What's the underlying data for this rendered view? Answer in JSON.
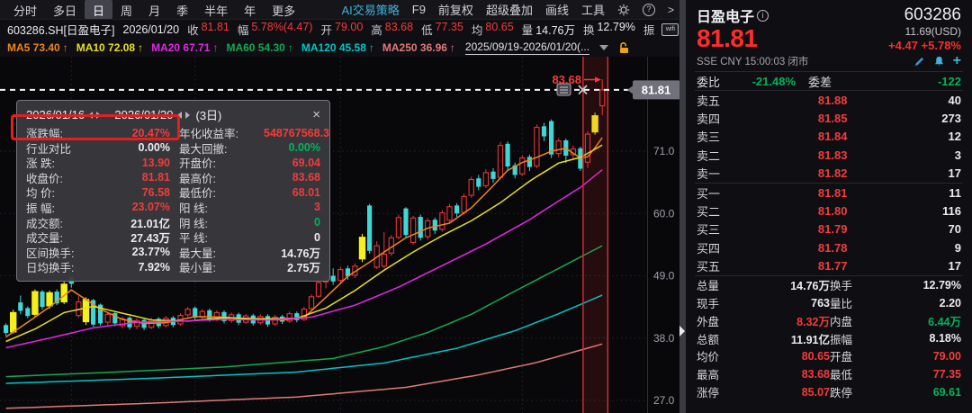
{
  "toolbar": {
    "tabs": [
      {
        "label": "分时",
        "active": false
      },
      {
        "label": "多日",
        "active": false
      },
      {
        "label": "日",
        "active": true
      },
      {
        "label": "周",
        "active": false
      },
      {
        "label": "月",
        "active": false
      },
      {
        "label": "季",
        "active": false
      },
      {
        "label": "半年",
        "active": false
      },
      {
        "label": "年",
        "active": false
      },
      {
        "label": "更多",
        "active": false
      }
    ],
    "right_items": [
      {
        "label": "AI交易策略",
        "accent": true
      },
      {
        "label": "F9",
        "accent": false
      },
      {
        "label": "前复权",
        "accent": false
      },
      {
        "label": "超级叠加",
        "accent": false
      },
      {
        "label": "画线",
        "accent": false
      },
      {
        "label": "工具",
        "accent": false
      }
    ],
    "help_label": "?",
    "chevron_label": ">"
  },
  "info_line": {
    "code": "603286.SH[日盈电子]",
    "date": "2026/01/20",
    "fields": [
      {
        "label": "收",
        "value": "81.81",
        "color": "r"
      },
      {
        "label": "幅",
        "value": "5.78%(4.47)",
        "color": "r"
      },
      {
        "label": "开",
        "value": "79.00",
        "color": "r"
      },
      {
        "label": "高",
        "value": "83.68",
        "color": "r"
      },
      {
        "label": "低",
        "value": "77.35",
        "color": "r"
      },
      {
        "label": "均",
        "value": "80.65",
        "color": "r"
      },
      {
        "label": "量",
        "value": "14.76万",
        "color": "w"
      },
      {
        "label": "换",
        "value": "12.79%",
        "color": "w"
      },
      {
        "label": "振",
        "value": "",
        "color": "w"
      }
    ],
    "cast_icon_text": "wifi"
  },
  "ma_line": {
    "items": [
      {
        "label": "MA5",
        "value": "73.40",
        "color": "#f0851d"
      },
      {
        "label": "MA10",
        "value": "72.08",
        "color": "#e8e020"
      },
      {
        "label": "MA20",
        "value": "67.71",
        "color": "#e129e1"
      },
      {
        "label": "MA60",
        "value": "54.30",
        "color": "#12a952"
      },
      {
        "label": "MA120",
        "value": "45.58",
        "color": "#00c5c5"
      },
      {
        "label": "MA250",
        "value": "36.96",
        "color": "#e07a7a"
      }
    ],
    "arrow": "↑",
    "range_text": "2025/09/19-2026/01/20(..."
  },
  "chart_data": {
    "type": "candlestick",
    "date_range": "2025/09/19-2026/01/20",
    "y_ticks": [
      71.0,
      60.0,
      49.0,
      38.0,
      27.0
    ],
    "v_grid_days": [
      9,
      26,
      46,
      71
    ],
    "price_line": {
      "value": 81.81,
      "label": "81.81"
    },
    "high_annotation": {
      "value": 83.68,
      "label": "83.68"
    },
    "selection": {
      "start_index": 80,
      "end_index": 82,
      "start_date": "2026/01/16",
      "end_date": "2026/01/20"
    },
    "up_color": "#e83535",
    "down_color": "#3fd6d6",
    "mark_color": "#f6ef1a",
    "candles": [
      [
        40.3,
        38.9,
        38.4,
        40.6,
        "c"
      ],
      [
        39.0,
        42.6,
        38.8,
        43.0,
        "y"
      ],
      [
        44.3,
        42.8,
        42.2,
        45.5,
        "c"
      ],
      [
        43.3,
        41.9,
        41.5,
        43.6,
        "c"
      ],
      [
        42.1,
        46.3,
        41.8,
        46.6,
        "y"
      ],
      [
        46.2,
        43.5,
        43.0,
        46.5,
        "c"
      ],
      [
        43.6,
        46.1,
        43.2,
        46.4,
        "y"
      ],
      [
        46.2,
        44.1,
        43.8,
        46.6,
        "c"
      ],
      [
        44.3,
        47.6,
        44.0,
        48.0,
        "y"
      ],
      [
        48.8,
        47.6,
        46.9,
        48.9,
        "c"
      ],
      [
        42.0,
        44.4,
        41.6,
        45.4,
        "r"
      ],
      [
        40.8,
        44.9,
        40.3,
        45.2,
        "y"
      ],
      [
        44.7,
        40.4,
        40.0,
        44.9,
        "c"
      ],
      [
        43.9,
        40.6,
        40.2,
        44.1,
        "c"
      ],
      [
        40.8,
        42.2,
        40.3,
        42.6,
        "r"
      ],
      [
        42.4,
        40.6,
        40.1,
        42.7,
        "c"
      ],
      [
        40.2,
        41.4,
        39.7,
        41.8,
        "r"
      ],
      [
        41.6,
        39.9,
        39.5,
        41.9,
        "c"
      ],
      [
        40.1,
        41.1,
        39.6,
        41.5,
        "r"
      ],
      [
        41.2,
        39.8,
        39.4,
        41.4,
        "c"
      ],
      [
        39.9,
        41.2,
        39.6,
        41.6,
        "r"
      ],
      [
        41.4,
        40.1,
        39.7,
        41.7,
        "c"
      ],
      [
        40.2,
        41.5,
        39.9,
        41.9,
        "r"
      ],
      [
        41.6,
        40.3,
        39.9,
        41.9,
        "c"
      ],
      [
        40.5,
        42.0,
        40.2,
        42.4,
        "r"
      ],
      [
        42.1,
        43.1,
        41.7,
        43.5,
        "r"
      ],
      [
        43.3,
        41.6,
        41.2,
        43.6,
        "c"
      ],
      [
        41.7,
        42.7,
        41.3,
        43.1,
        "r"
      ],
      [
        42.9,
        41.3,
        40.9,
        43.2,
        "c"
      ],
      [
        41.4,
        42.5,
        41.0,
        42.9,
        "r"
      ],
      [
        42.6,
        41.0,
        40.6,
        42.9,
        "c"
      ],
      [
        41.1,
        42.1,
        40.7,
        42.5,
        "r"
      ],
      [
        42.2,
        40.7,
        40.3,
        42.5,
        "c"
      ],
      [
        40.8,
        41.9,
        40.5,
        42.3,
        "r"
      ],
      [
        42.0,
        40.6,
        40.2,
        42.3,
        "c"
      ],
      [
        40.7,
        41.8,
        40.4,
        42.2,
        "r"
      ],
      [
        41.9,
        40.4,
        40.0,
        42.2,
        "c"
      ],
      [
        40.5,
        41.7,
        40.2,
        42.1,
        "r"
      ],
      [
        41.8,
        40.9,
        40.5,
        42.1,
        "c"
      ],
      [
        41.0,
        42.3,
        40.7,
        42.7,
        "r"
      ],
      [
        42.4,
        41.2,
        40.8,
        42.7,
        "c"
      ],
      [
        41.3,
        43.1,
        41.0,
        43.5,
        "r"
      ],
      [
        43.2,
        45.3,
        42.9,
        45.7,
        "r"
      ],
      [
        45.4,
        47.8,
        45.1,
        48.2,
        "r"
      ],
      [
        47.9,
        48.6,
        46.8,
        49.3,
        "r"
      ],
      [
        49.0,
        48.0,
        47.4,
        50.3,
        "c"
      ],
      [
        48.2,
        50.1,
        47.8,
        50.6,
        "r"
      ],
      [
        50.3,
        48.9,
        48.3,
        50.8,
        "c"
      ],
      [
        49.1,
        50.7,
        48.6,
        51.2,
        "r"
      ],
      [
        51.9,
        55.9,
        51.4,
        56.4,
        "y"
      ],
      [
        61.4,
        53.4,
        52.9,
        61.7,
        "c"
      ],
      [
        50.5,
        54.3,
        50.2,
        55.1,
        "r"
      ],
      [
        50.7,
        52.8,
        50.3,
        56.7,
        "r"
      ],
      [
        53.0,
        55.7,
        52.5,
        56.2,
        "r"
      ],
      [
        55.8,
        59.3,
        55.4,
        59.8,
        "r"
      ],
      [
        60.9,
        56.2,
        55.7,
        61.1,
        "c"
      ],
      [
        54.9,
        59.2,
        54.5,
        59.6,
        "r"
      ],
      [
        59.4,
        55.7,
        55.2,
        59.8,
        "c"
      ],
      [
        55.9,
        58.7,
        55.4,
        59.2,
        "r"
      ],
      [
        58.9,
        57.0,
        56.4,
        59.3,
        "c"
      ],
      [
        57.2,
        60.1,
        56.8,
        60.6,
        "r"
      ],
      [
        58.8,
        61.2,
        58.4,
        61.7,
        "r"
      ],
      [
        61.4,
        60.0,
        59.4,
        61.8,
        "c"
      ],
      [
        60.2,
        63.0,
        59.8,
        63.5,
        "r"
      ],
      [
        63.2,
        66.0,
        62.8,
        66.5,
        "r"
      ],
      [
        66.2,
        64.7,
        64.1,
        66.8,
        "c"
      ],
      [
        64.9,
        67.2,
        64.5,
        67.8,
        "r"
      ],
      [
        67.4,
        66.1,
        65.4,
        68.0,
        "c"
      ],
      [
        66.4,
        72.0,
        66.0,
        72.6,
        "r"
      ],
      [
        72.3,
        68.3,
        67.6,
        72.7,
        "c"
      ],
      [
        68.5,
        66.8,
        66.2,
        69.0,
        "c"
      ],
      [
        67.0,
        69.8,
        66.6,
        70.3,
        "r"
      ],
      [
        70.0,
        68.2,
        67.5,
        70.4,
        "c"
      ],
      [
        68.4,
        75.2,
        68.0,
        75.7,
        "r"
      ],
      [
        75.4,
        73.6,
        72.8,
        76.0,
        "c"
      ],
      [
        76.3,
        70.4,
        69.8,
        76.6,
        "c"
      ],
      [
        70.6,
        72.8,
        69.9,
        73.3,
        "r"
      ],
      [
        72.9,
        70.2,
        68.9,
        73.2,
        "c"
      ],
      [
        70.4,
        71.4,
        69.6,
        72.0,
        "r"
      ],
      [
        71.5,
        67.91,
        67.5,
        71.8,
        "c"
      ],
      [
        69.04,
        74.0,
        68.01,
        74.5,
        "r"
      ],
      [
        74.3,
        77.34,
        73.9,
        77.8,
        "y"
      ],
      [
        79.0,
        81.81,
        77.35,
        83.68,
        "r"
      ]
    ],
    "ma_series": [
      {
        "name": "MA5",
        "color": "#f0851d",
        "points": [
          [
            0,
            38.2
          ],
          [
            3,
            40.8
          ],
          [
            6,
            43.5
          ],
          [
            9,
            46.5
          ],
          [
            11,
            44.8
          ],
          [
            13,
            43.1
          ],
          [
            16,
            41.3
          ],
          [
            19,
            40.6
          ],
          [
            22,
            40.7
          ],
          [
            26,
            41.8
          ],
          [
            30,
            41.7
          ],
          [
            34,
            41.3
          ],
          [
            38,
            41.2
          ],
          [
            41,
            41.6
          ],
          [
            44,
            45.2
          ],
          [
            47,
            48.9
          ],
          [
            50,
            51.4
          ],
          [
            52,
            53.2
          ],
          [
            55,
            55.7
          ],
          [
            58,
            57.4
          ],
          [
            61,
            58.3
          ],
          [
            64,
            61.0
          ],
          [
            67,
            64.9
          ],
          [
            69,
            67.6
          ],
          [
            71,
            69.0
          ],
          [
            73,
            69.9
          ],
          [
            75,
            71.0
          ],
          [
            77,
            71.5
          ],
          [
            79,
            69.8
          ],
          [
            80,
            70.0
          ],
          [
            81,
            71.6
          ],
          [
            82,
            73.4
          ]
        ]
      },
      {
        "name": "MA10",
        "color": "#e8e020",
        "points": [
          [
            0,
            37.4
          ],
          [
            4,
            39.6
          ],
          [
            8,
            42.5
          ],
          [
            12,
            43.6
          ],
          [
            16,
            42.4
          ],
          [
            20,
            41.2
          ],
          [
            25,
            41.0
          ],
          [
            30,
            41.6
          ],
          [
            35,
            41.4
          ],
          [
            40,
            41.5
          ],
          [
            44,
            43.3
          ],
          [
            48,
            46.4
          ],
          [
            52,
            50.0
          ],
          [
            56,
            53.2
          ],
          [
            60,
            56.1
          ],
          [
            64,
            58.7
          ],
          [
            68,
            61.9
          ],
          [
            72,
            65.7
          ],
          [
            76,
            68.9
          ],
          [
            79,
            69.9
          ],
          [
            82,
            72.08
          ]
        ]
      },
      {
        "name": "MA20",
        "color": "#e129e1",
        "points": [
          [
            0,
            36.3
          ],
          [
            6,
            38.0
          ],
          [
            12,
            39.8
          ],
          [
            18,
            40.8
          ],
          [
            24,
            41.0
          ],
          [
            30,
            41.3
          ],
          [
            36,
            41.2
          ],
          [
            42,
            41.7
          ],
          [
            48,
            43.8
          ],
          [
            54,
            47.0
          ],
          [
            60,
            50.8
          ],
          [
            66,
            54.6
          ],
          [
            72,
            58.9
          ],
          [
            76,
            62.2
          ],
          [
            79,
            64.6
          ],
          [
            82,
            67.71
          ]
        ]
      },
      {
        "name": "MA60",
        "color": "#12a952",
        "points": [
          [
            0,
            31.2
          ],
          [
            15,
            32.0
          ],
          [
            30,
            32.9
          ],
          [
            45,
            34.4
          ],
          [
            52,
            36.5
          ],
          [
            58,
            39.0
          ],
          [
            64,
            42.2
          ],
          [
            70,
            46.3
          ],
          [
            76,
            50.3
          ],
          [
            82,
            54.3
          ]
        ]
      },
      {
        "name": "MA120",
        "color": "#00c5c5",
        "points": [
          [
            0,
            30.0
          ],
          [
            20,
            30.9
          ],
          [
            40,
            32.0
          ],
          [
            52,
            33.6
          ],
          [
            62,
            36.2
          ],
          [
            70,
            39.3
          ],
          [
            76,
            42.3
          ],
          [
            82,
            45.58
          ]
        ]
      },
      {
        "name": "MA250",
        "color": "#e07a7a",
        "points": [
          [
            0,
            25.6
          ],
          [
            20,
            26.5
          ],
          [
            40,
            27.6
          ],
          [
            55,
            29.3
          ],
          [
            65,
            31.5
          ],
          [
            73,
            33.7
          ],
          [
            82,
            36.96
          ]
        ]
      }
    ]
  },
  "popup": {
    "date_from": "2026/01/16",
    "dash": "-",
    "date_to": "2026/01/20",
    "span": "(3日)",
    "close": "×",
    "rows": [
      [
        "涨跌幅:",
        "20.47%",
        "r",
        "年化收益率:",
        "548767568.3",
        "r"
      ],
      [
        "行业对比",
        "0.00%",
        "w",
        "最大回撤:",
        "0.00%",
        "g"
      ],
      [
        "涨 跌:",
        "13.90",
        "r",
        "开盘价:",
        "69.04",
        "r"
      ],
      [
        "收盘价:",
        "81.81",
        "r",
        "最高价:",
        "83.68",
        "r"
      ],
      [
        "均 价:",
        "76.58",
        "r",
        "最低价:",
        "68.01",
        "r"
      ],
      [
        "振 幅:",
        "23.07%",
        "r",
        "阳 线:",
        "3",
        "r"
      ],
      [
        "成交额:",
        "21.01亿",
        "w",
        "阴 线:",
        "0",
        "g"
      ],
      [
        "成交量:",
        "27.43万",
        "w",
        "平 线:",
        "0",
        "w"
      ],
      [
        "区间换手:",
        "23.77%",
        "w",
        "最大量:",
        "14.76万",
        "w"
      ],
      [
        "日均换手:",
        "7.92%",
        "w",
        "最小量:",
        "2.75万",
        "w"
      ]
    ]
  },
  "panel": {
    "name": "日盈电子",
    "info_badge": "i",
    "code": "603286",
    "price": "81.81",
    "usd": "11.69(USD)",
    "change": "+4.47  +5.78%",
    "meta": "SSE  CNY  15:00:03  闭市",
    "weibi": {
      "l1": "委比",
      "v1": "-21.48%",
      "l2": "委差",
      "v2": "-122"
    },
    "asks": [
      [
        "卖五",
        "81.88",
        "40"
      ],
      [
        "卖四",
        "81.85",
        "273"
      ],
      [
        "卖三",
        "81.84",
        "12"
      ],
      [
        "卖二",
        "81.83",
        "3"
      ],
      [
        "卖一",
        "81.82",
        "17"
      ]
    ],
    "bids": [
      [
        "买一",
        "81.81",
        "11"
      ],
      [
        "买二",
        "81.80",
        "116"
      ],
      [
        "买三",
        "81.79",
        "70"
      ],
      [
        "买四",
        "81.78",
        "9"
      ],
      [
        "买五",
        "81.77",
        "17"
      ]
    ],
    "stats": [
      [
        "总量",
        "14.76万",
        "w",
        "换手",
        "12.79%",
        "w"
      ],
      [
        "现手",
        "763",
        "w",
        "量比",
        "2.20",
        "w"
      ],
      [
        "外盘",
        "8.32万",
        "r",
        "内盘",
        "6.44万",
        "g"
      ],
      [
        "总额",
        "11.91亿",
        "w",
        "振幅",
        "8.18%",
        "w"
      ],
      [
        "均价",
        "80.65",
        "r",
        "开盘",
        "79.00",
        "r"
      ],
      [
        "最高",
        "83.68",
        "r",
        "最低",
        "77.35",
        "r"
      ],
      [
        "涨停",
        "85.07",
        "r",
        "跌停",
        "69.61",
        "g"
      ]
    ]
  },
  "colors": {
    "red": "#f23c3c",
    "green": "#00b45a",
    "accent": "#3fb3d9",
    "price_red": "#fb2d2d"
  }
}
